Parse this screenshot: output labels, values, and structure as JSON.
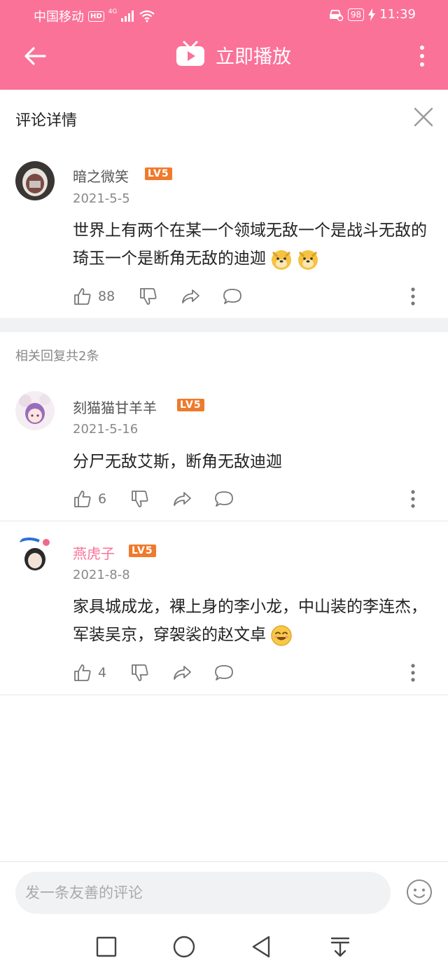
{
  "status_bar": {
    "carrier": "中国移动",
    "hd": "HD",
    "network": "4G",
    "battery": "98",
    "time": "11:39"
  },
  "header": {
    "title": "立即播放",
    "color": "#fb7299"
  },
  "panel": {
    "title": "评论详情"
  },
  "main_comment": {
    "user": "暗之微笑",
    "level": "LV5",
    "date": "2021-5-5",
    "text": "世界上有两个在某一个领域无敌一个是战斗无敌的琦玉一个是断角无敌的迪迦",
    "emojis": [
      "doge-emoji",
      "doge-emoji"
    ],
    "likes": "88"
  },
  "replies": {
    "count_label": "相关回复共2条",
    "items": [
      {
        "user": "刻猫猫甘羊羊",
        "level": "LV5",
        "date": "2021-5-16",
        "text": "分尸无敌艾斯，断角无敌迪迦",
        "likes": "6"
      },
      {
        "user": "燕虎子",
        "level": "LV5",
        "date": "2021-8-8",
        "text": "家具城成龙，裸上身的李小龙，中山装的李连杰，军装吴京，穿袈裟的赵文卓",
        "emoji": "smile-emoji",
        "likes": "4"
      }
    ]
  },
  "input": {
    "placeholder": "发一条友善的评论"
  }
}
